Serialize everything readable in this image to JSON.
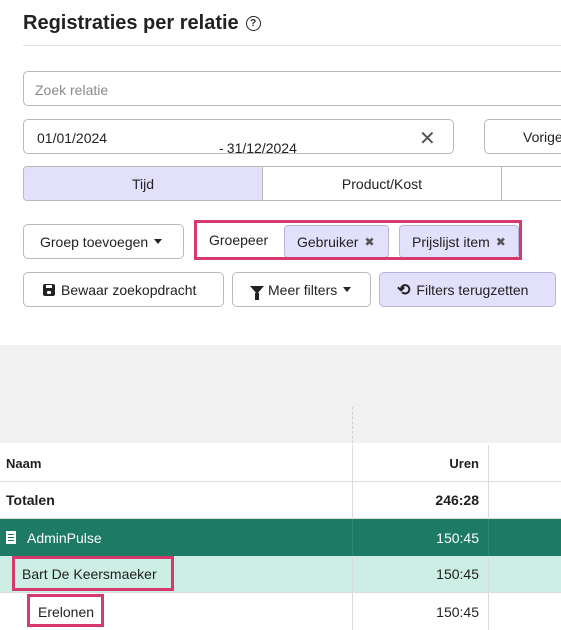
{
  "page": {
    "title": "Registraties per relatie",
    "help_glyph": "?"
  },
  "search": {
    "placeholder": "Zoek relatie"
  },
  "date_range": {
    "from": "01/01/2024",
    "separator": "-",
    "to": "31/12/2024",
    "clear_glyph": "✕"
  },
  "vorige": {
    "label": "Vorige"
  },
  "tabs": [
    {
      "label": "Tijd",
      "active": true
    },
    {
      "label": "Product/Kost",
      "active": false
    },
    {
      "label": "",
      "active": false
    }
  ],
  "toolbar": {
    "add_group_label": "Groep toevoegen",
    "group_by_label": "Groepeer",
    "chips": [
      {
        "label": "Gebruiker",
        "remove_glyph": "✖"
      },
      {
        "label": "Prijslijst item",
        "remove_glyph": "✖"
      }
    ],
    "save_label": "Bewaar zoekopdracht",
    "more_filters_label": "Meer filters",
    "reset_label": "Filters terugzetten",
    "reset_glyph": "⟲"
  },
  "table": {
    "columns": {
      "name": "Naam",
      "hours": "Uren"
    },
    "totals": {
      "name": "Totalen",
      "hours": "246:28"
    },
    "group_row": {
      "name": "AdminPulse",
      "hours": "150:45"
    },
    "sub_row": {
      "name": "Bart De Keersmaeker",
      "hours": "150:45"
    },
    "item_row": {
      "name": "Erelonen",
      "hours": "150:45"
    }
  },
  "colors": {
    "accent_light": "#e3e0fb",
    "group_green": "#1d7a64",
    "sub_green": "#cdeee4",
    "highlight": "#d63a6a"
  }
}
